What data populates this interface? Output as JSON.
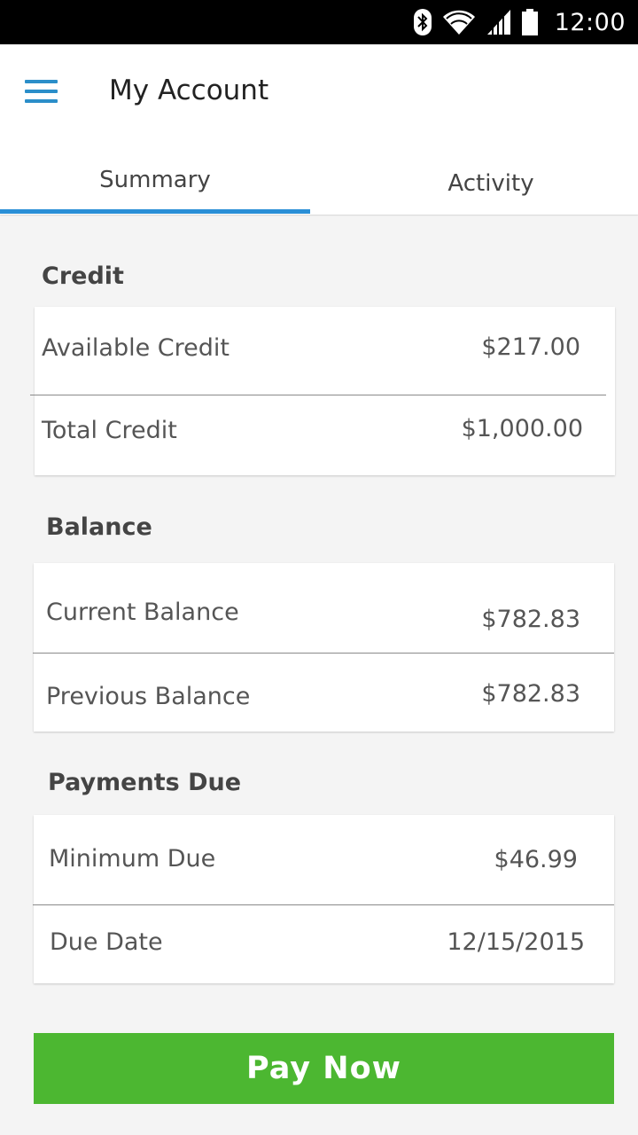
{
  "status_bar": {
    "time": "12:00"
  },
  "header": {
    "title": "My Account",
    "menu_icon": "hamburger-menu-icon"
  },
  "tabs": [
    {
      "label": "Summary",
      "selected": true
    },
    {
      "label": "Activity",
      "selected": false
    }
  ],
  "credit": {
    "title": "Credit",
    "rows": [
      {
        "label": "Available Credit",
        "value": "$217.00"
      },
      {
        "label": "Total Credit",
        "value": "$1,000.00"
      }
    ]
  },
  "balance": {
    "title": "Balance",
    "rows": [
      {
        "label": "Current Balance",
        "value": "$782.83"
      },
      {
        "label": "Previous Balance",
        "value": "$782.83"
      }
    ]
  },
  "payments": {
    "title": "Payments Due",
    "rows": [
      {
        "label": "Minimum Due",
        "value": "$46.99"
      },
      {
        "label": "Due Date",
        "value": "12/15/2015"
      }
    ]
  },
  "pay_button": {
    "label": "Pay Now"
  },
  "colors": {
    "accent": "#2a8fd6",
    "pay_button": "#4cb731",
    "menu_icon": "#2b8ec9"
  }
}
